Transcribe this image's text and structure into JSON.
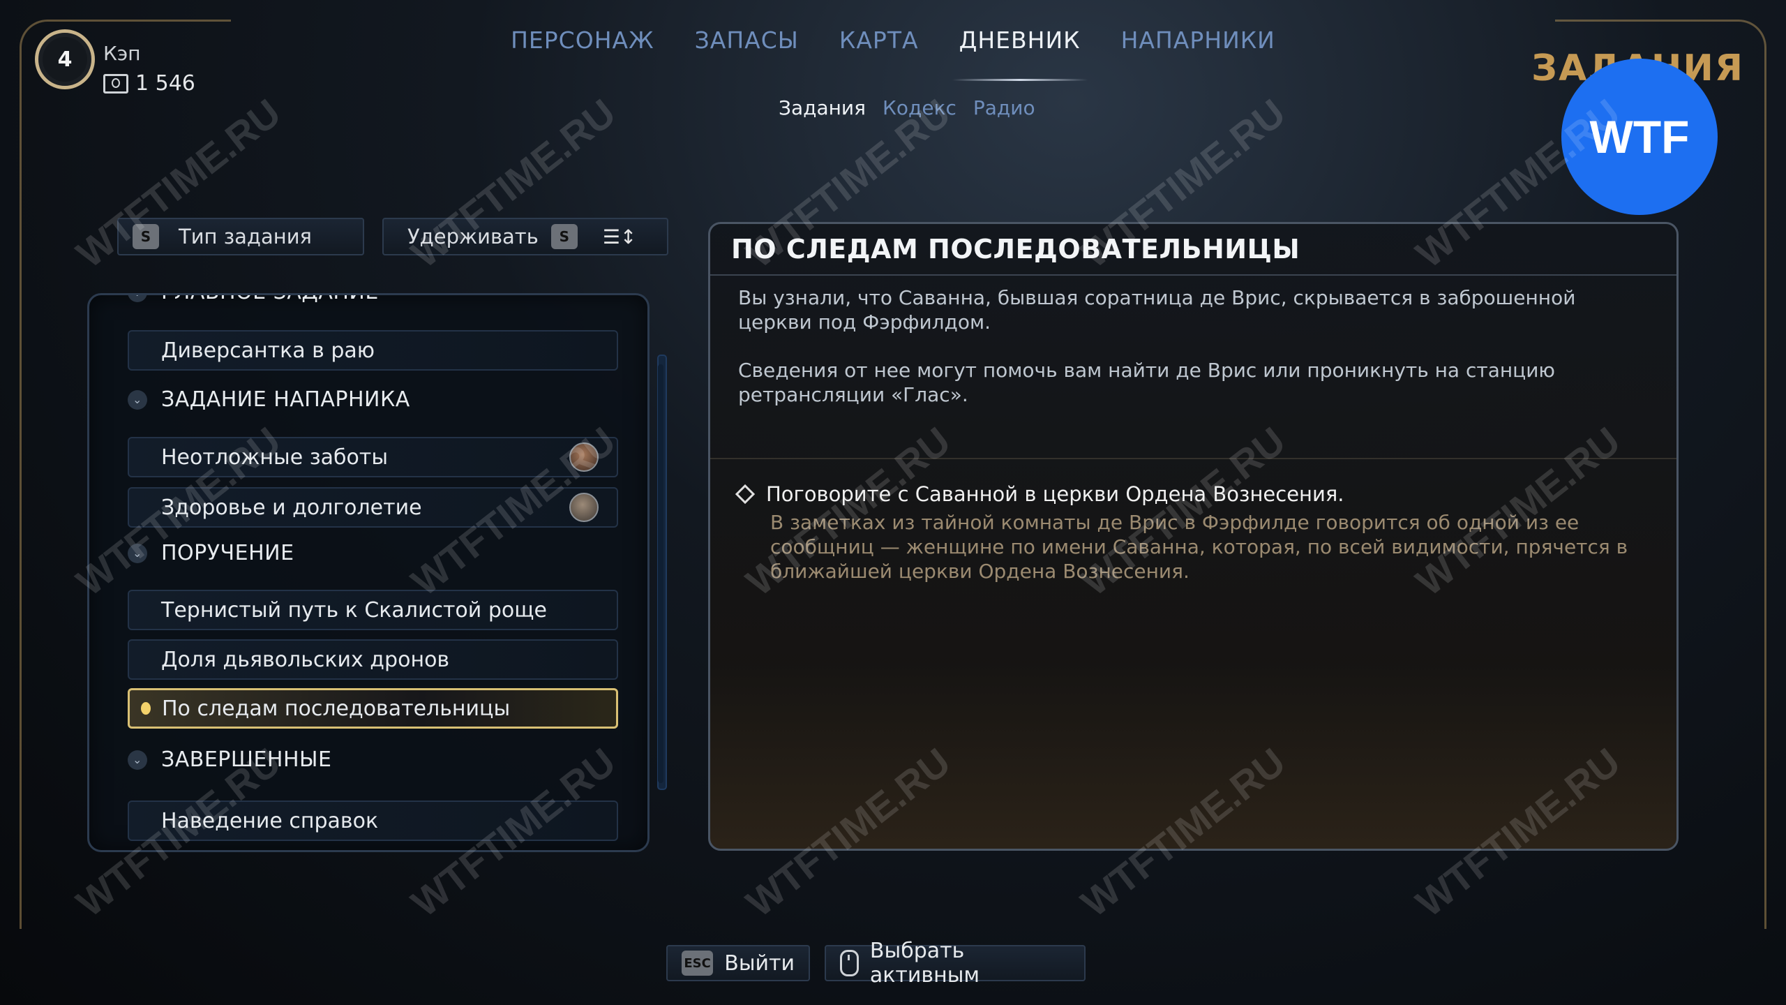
{
  "player": {
    "level": "4",
    "name": "Кэп",
    "money": "1 546"
  },
  "nav": {
    "tabs": [
      "ПЕРСОНАЖ",
      "ЗАПАСЫ",
      "КАРТА",
      "ДНЕВНИК",
      "НАПАРНИКИ"
    ],
    "active": "ДНЕВНИК"
  },
  "subnav": {
    "items": [
      "Задания",
      "Кодекс",
      "Радио"
    ],
    "active": "Задания"
  },
  "section_title": "ЗАДАНИЯ",
  "badge": "WTF",
  "filters": {
    "type_key": "S",
    "type_label": "Тип задания",
    "hold_label": "Удерживать",
    "hold_key": "S"
  },
  "list": {
    "categories": {
      "main": "ГЛАВНОЕ ЗАДАНИЕ",
      "companion": "ЗАДАНИЕ НАПАРНИКА",
      "errand": "ПОРУЧЕНИЕ",
      "completed": "ЗАВЕРШЕННЫЕ"
    },
    "main_quests": [
      "Диверсантка в раю"
    ],
    "companion_quests": [
      "Неотложные заботы",
      "Здоровье и долголетие"
    ],
    "errand_quests": [
      "Тернистый путь к Скалистой роще",
      "Доля дьявольских дронов",
      "По следам последовательницы"
    ],
    "completed_quests": [
      "Наведение справок"
    ],
    "selected": "По следам последовательницы"
  },
  "detail": {
    "title": "ПО СЛЕДАМ ПОСЛЕДОВАТЕЛЬНИЦЫ",
    "description_1": "Вы узнали, что Саванна, бывшая соратница де Врис, скрывается в заброшенной церкви под Фэрфилдом.",
    "description_2": "Сведения от нее могут помочь вам найти де Врис или проникнуть на станцию ретрансляции «Глас».",
    "objective_title": "Поговорите с Саванной в церкви Ордена Вознесения.",
    "objective_note": "В заметках из тайной комнаты де Врис в Фэрфилде говорится об одной из ее сообщниц — женщине по имени Саванна, которая, по всей видимости, прячется в ближайшей церкви Ордена Вознесения."
  },
  "bottom": {
    "esc_key": "ESC",
    "exit_label": "Выйти",
    "activate_label": "Выбрать активным"
  },
  "watermark": "WTFTIME.RU"
}
